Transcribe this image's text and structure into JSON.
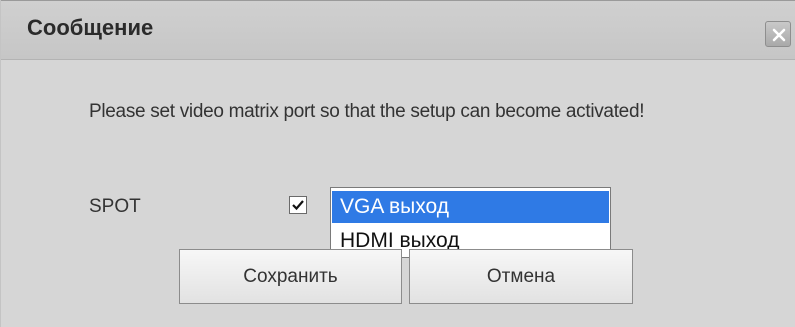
{
  "dialog": {
    "title": "Сообщение",
    "close_icon": "close-icon",
    "message": "Please set video matrix port so that the setup can become activated!",
    "spot": {
      "label": "SPOT",
      "checked": true,
      "options": [
        "VGA выход",
        "HDMI выход"
      ],
      "selected": "VGA выход"
    },
    "buttons": {
      "save": "Сохранить",
      "cancel": "Отмена"
    }
  },
  "colors": {
    "selection": "#2f7ae5",
    "background": "#d6d6d6"
  }
}
